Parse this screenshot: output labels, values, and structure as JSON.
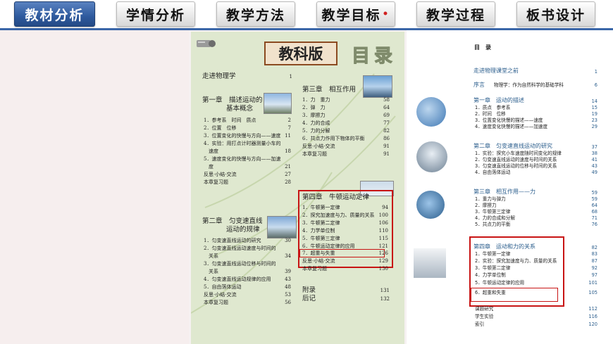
{
  "tabs": [
    {
      "label": "教材分析",
      "active": true
    },
    {
      "label": "学情分析",
      "active": false
    },
    {
      "label": "教学方法",
      "active": false
    },
    {
      "label": "教学目标",
      "active": false,
      "dot": "•"
    },
    {
      "label": "教学过程",
      "active": false
    },
    {
      "label": "板书设计",
      "active": false
    }
  ],
  "middle_toc": {
    "brand": "教科版",
    "title": "目录",
    "intro": {
      "label": "走进物理学",
      "page": "1"
    },
    "ch1": {
      "label1": "第一章　描述运动的",
      "label2": "基本概念",
      "items": [
        {
          "label": "1．参考系　时间　质点",
          "page": "2"
        },
        {
          "label": "2．位置　位移",
          "page": "7"
        },
        {
          "label": "3．位置变化的快慢与方向——速度",
          "page": "11"
        },
        {
          "label": "4．实验：用打点计时器测量小车的",
          "page": ""
        },
        {
          "label": "　速度",
          "page": "18"
        },
        {
          "label": "5．速度变化的快慢与方向——加速",
          "page": ""
        },
        {
          "label": "　度",
          "page": "21"
        },
        {
          "label": "反思·小结·交流",
          "page": "27"
        },
        {
          "label": "本章复习题",
          "page": "28"
        }
      ]
    },
    "ch2": {
      "label1": "第二章　匀变速直线",
      "label2": "运动的规律",
      "items": [
        {
          "label": "1．匀变速直线运动的研究",
          "page": "30"
        },
        {
          "label": "2．匀变速直线运动速度与时间的",
          "page": ""
        },
        {
          "label": "　关系",
          "page": "34"
        },
        {
          "label": "3．匀变速直线运动位移与时间的",
          "page": ""
        },
        {
          "label": "　关系",
          "page": "39"
        },
        {
          "label": "4．匀变速直线运动规律的应用",
          "page": "43"
        },
        {
          "label": "5．自由落体运动",
          "page": "48"
        },
        {
          "label": "反思·小结·交流",
          "page": "53"
        },
        {
          "label": "本章复习题",
          "page": "56"
        }
      ]
    },
    "ch3": {
      "label": "第三章　相互作用",
      "items": [
        {
          "label": "1．力　重力",
          "page": "58"
        },
        {
          "label": "2．弹　力",
          "page": "64"
        },
        {
          "label": "3．摩擦力",
          "page": "69"
        },
        {
          "label": "4．力的合成",
          "page": "77"
        },
        {
          "label": "5．力的分解",
          "page": "82"
        },
        {
          "label": "6．共点力作用下物体的平衡",
          "page": "86"
        },
        {
          "label": "反思·小结·交流",
          "page": "91"
        },
        {
          "label": "本章复习题",
          "page": "91"
        }
      ]
    },
    "ch4": {
      "label": "第四章　牛顿运动定律",
      "items": [
        {
          "label": "1．牛顿第一定律",
          "page": "94"
        },
        {
          "label": "2．探究加速度与力、质量的关系",
          "page": "100"
        },
        {
          "label": "3．牛顿第二定律",
          "page": "106"
        },
        {
          "label": "4．力学单位制",
          "page": "110"
        },
        {
          "label": "5．牛顿第三定律",
          "page": "115"
        },
        {
          "label": "6．牛顿运动定律的应用",
          "page": "121"
        },
        {
          "label": "7．超重与失重",
          "page": "126"
        },
        {
          "label": "反思·小结·交流",
          "page": "129"
        },
        {
          "label": "本章复习题",
          "page": "130"
        }
      ]
    },
    "appendix": [
      {
        "label": "附录",
        "page": "131"
      },
      {
        "label": "后记",
        "page": "132"
      }
    ]
  },
  "right_toc": {
    "title": "目　录",
    "intro": {
      "label": "走进物理课堂之前",
      "page": "1"
    },
    "preface": {
      "label": "序言",
      "sub": "物理学：作为自然科学的基础学科",
      "page": "6"
    },
    "ch1": {
      "label": "第一章　运动的描述",
      "page": "14",
      "items": [
        {
          "label": "1．质点　参考系",
          "page": "15"
        },
        {
          "label": "2．时间　位移",
          "page": "19"
        },
        {
          "label": "3．位置变化快慢的描述——速度",
          "page": "23"
        },
        {
          "label": "4．速度变化快慢的描述——加速度",
          "page": "29"
        }
      ]
    },
    "ch2": {
      "label": "第二章　匀变速直线运动的研究",
      "page": "37",
      "items": [
        {
          "label": "1．实验：探究小车速度随时间变化的规律",
          "page": "38"
        },
        {
          "label": "2．匀变速直线运动的速度与时间的关系",
          "page": "41"
        },
        {
          "label": "3．匀变速直线运动的位移与时间的关系",
          "page": "43"
        },
        {
          "label": "4．自由落体运动",
          "page": "49"
        }
      ]
    },
    "ch3": {
      "label": "第三章　相互作用——力",
      "page": "59",
      "items": [
        {
          "label": "1．重力与弹力",
          "page": "59"
        },
        {
          "label": "2．摩擦力",
          "page": "64"
        },
        {
          "label": "3．牛顿第三定律",
          "page": "68"
        },
        {
          "label": "4．力的合成和分解",
          "page": "71"
        },
        {
          "label": "5．共点力的平衡",
          "page": "76"
        }
      ]
    },
    "ch4": {
      "label": "第四章　运动和力的关系",
      "page": "82",
      "items": [
        {
          "label": "1．牛顿第一定律",
          "page": "83"
        },
        {
          "label": "2．实验：探究加速度与力、质量的关系",
          "page": "87"
        },
        {
          "label": "3．牛顿第二定律",
          "page": "92"
        },
        {
          "label": "4．力学单位制",
          "page": "97"
        },
        {
          "label": "5．牛顿运动定律的应用",
          "page": "101"
        },
        {
          "label": "6．超重和失重",
          "page": "105"
        }
      ]
    },
    "tail": [
      {
        "label": "课题研究",
        "page": "112"
      },
      {
        "label": "学生实验",
        "page": "116"
      },
      {
        "label": "索引",
        "page": "120"
      }
    ]
  },
  "colors": {
    "accent": "#2e5a9e",
    "highlight": "#c81414",
    "page_green": "#dfe8cf",
    "toc_blue": "#2a5d8c"
  }
}
